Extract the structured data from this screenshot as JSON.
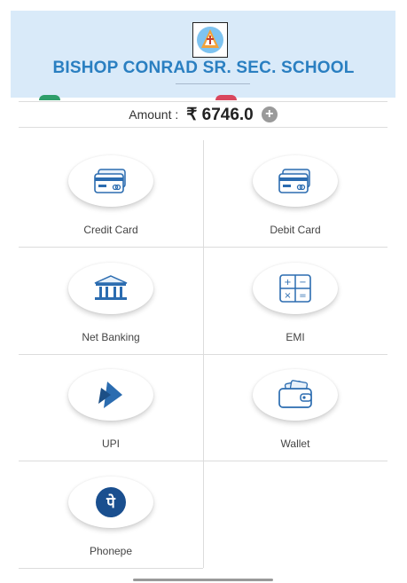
{
  "header": {
    "school_name": "BISHOP CONRAD SR. SEC. SCHOOL",
    "logo_icon": "school-crest-icon"
  },
  "amount": {
    "label": "Amount :",
    "currency": "₹",
    "value": "6746.0",
    "expand_icon": "plus-circle-icon"
  },
  "payment_options": [
    {
      "label": "Credit Card",
      "icon": "credit-card-icon"
    },
    {
      "label": "Debit Card",
      "icon": "debit-card-icon"
    },
    {
      "label": "Net Banking",
      "icon": "bank-icon"
    },
    {
      "label": "EMI",
      "icon": "calculator-icon"
    },
    {
      "label": "UPI",
      "icon": "upi-icon"
    },
    {
      "label": "Wallet",
      "icon": "wallet-icon"
    },
    {
      "label": "Phonepe",
      "icon": "phonepe-icon"
    }
  ],
  "colors": {
    "header_bg": "#d9eaf9",
    "school_name": "#2a7fc1",
    "icon_blue": "#2b6cb0",
    "phonepe": "#1a4f8f"
  }
}
